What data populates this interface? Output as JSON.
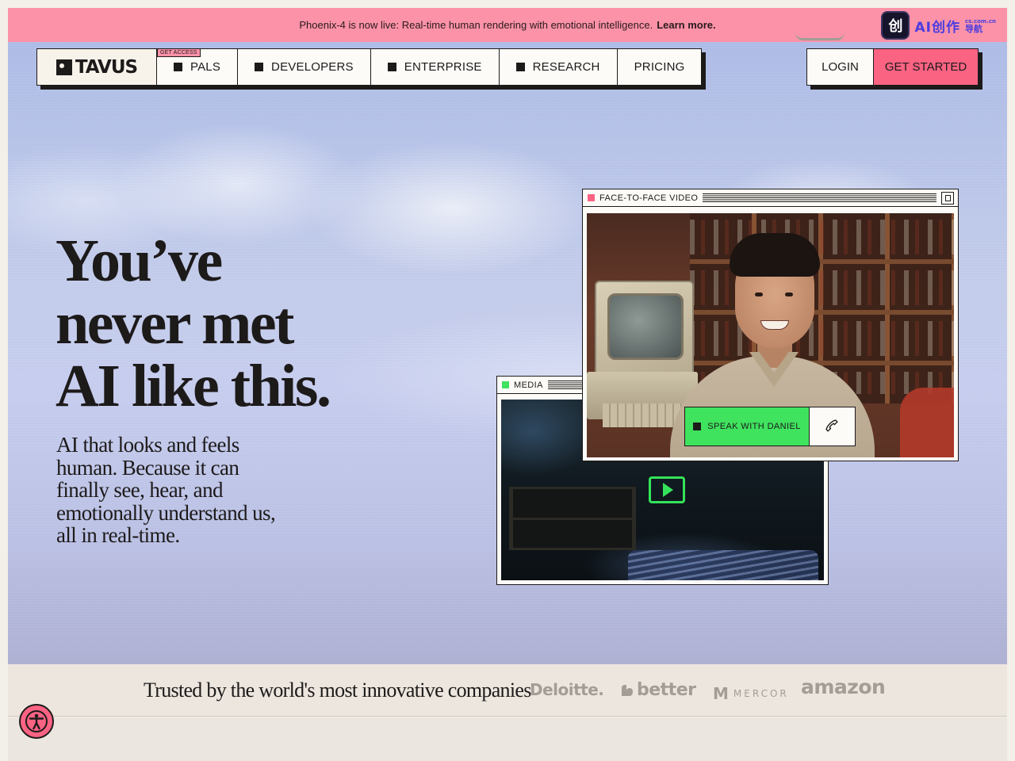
{
  "announcement": {
    "text": "Phoenix-4 is now live: Real-time human rendering with emotional intelligence.",
    "link_label": "Learn more."
  },
  "ai_badge": {
    "tile_glyph": "创",
    "label": "AI创作",
    "sub_top": "cs.com.cn",
    "sub_bottom": "导航"
  },
  "brand": {
    "logo_text": "TAVUS"
  },
  "nav": {
    "items": [
      {
        "label": "PALS",
        "tag": "GET ACCESS",
        "has_square": true
      },
      {
        "label": "DEVELOPERS",
        "has_square": true
      },
      {
        "label": "ENTERPRISE",
        "has_square": true
      },
      {
        "label": "RESEARCH",
        "has_square": true
      },
      {
        "label": "PRICING",
        "has_square": false
      }
    ]
  },
  "auth": {
    "login_label": "LOGIN",
    "get_started_label": "GET STARTED"
  },
  "hero": {
    "headline": "You’ve\nnever met\nAI like this.",
    "subhead": "AI that looks and feels\nhuman. Because it can\nfinally see, hear, and\nemotionally understand us,\nall in real-time."
  },
  "windows": {
    "media": {
      "title": "MEDIA",
      "dot_color": "#3fe35e"
    },
    "face": {
      "title": "FACE-TO-FACE VIDEO",
      "dot_color": "#fb6383"
    }
  },
  "speak": {
    "label": "SPEAK WITH DANIEL",
    "call_icon": "phone-icon"
  },
  "trusted": {
    "label": "Trusted by the world's most innovative companies",
    "logos": [
      "Deloitte.",
      "better",
      "MERCOR",
      "amazon"
    ]
  },
  "colors": {
    "pink_banner": "#fb92a8",
    "accent_pink": "#fb6383",
    "accent_green": "#3fe35e",
    "ink": "#1d1a1a"
  }
}
